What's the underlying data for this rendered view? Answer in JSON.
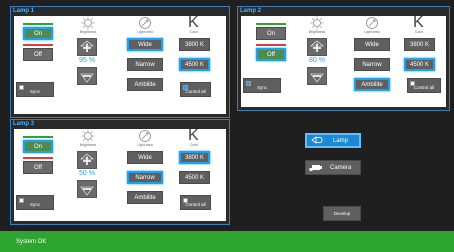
{
  "lamps": [
    {
      "title": "Lamp 1",
      "on_label": "On",
      "off_label": "Off",
      "brightness_caption": "Brightness",
      "light_area_caption": "Light area",
      "color_caption": "Color",
      "k_symbol": "K",
      "brightness_value": "95 %",
      "wide_label": "Wide",
      "narrow_label": "Narrow",
      "ambilite_label": "Ambilite",
      "k3800_label": "3800 K",
      "k4500_label": "4500 K",
      "sync_label": "Sync",
      "control_all_label": "Control all",
      "state": "On",
      "light_area": "Wide",
      "color": "4500 K",
      "sync_checked": false,
      "control_all_checked": true
    },
    {
      "title": "Lamp 2",
      "on_label": "On",
      "off_label": "Off",
      "brightness_caption": "Brightness",
      "light_area_caption": "Light area",
      "color_caption": "Color",
      "k_symbol": "K",
      "brightness_value": "80 %",
      "wide_label": "Wide",
      "narrow_label": "Narrow",
      "ambilite_label": "Ambilite",
      "k3800_label": "3800 K",
      "k4500_label": "4500 K",
      "sync_label": "Sync",
      "control_all_label": "Control all",
      "state": "Off",
      "light_area": "Ambilite",
      "color": "4500 K",
      "sync_checked": true,
      "control_all_checked": false
    },
    {
      "title": "Lamp 3",
      "on_label": "On",
      "off_label": "Off",
      "brightness_caption": "Brightness",
      "light_area_caption": "Light area",
      "color_caption": "Color",
      "k_symbol": "K",
      "brightness_value": "50 %",
      "wide_label": "Wide",
      "narrow_label": "Narrow",
      "ambilite_label": "Ambilite",
      "k3800_label": "3800 K",
      "k4500_label": "4500 K",
      "sync_label": "Sync",
      "control_all_label": "Control all",
      "state": "On",
      "light_area": "Narrow",
      "color": "3800 K",
      "sync_checked": false,
      "control_all_checked": false
    }
  ],
  "nav": {
    "lamp_label": "Lamp",
    "camera_label": "Camera",
    "development_label": "Develop"
  },
  "status": {
    "text": "System OK"
  },
  "colors": {
    "accent": "#1da1f2",
    "panel_border": "#3a7dbf",
    "title": "#4fb0ff",
    "status_bar": "#2ea52e",
    "on_bar": "#2ea52e",
    "off_bar": "#e03c3c"
  }
}
